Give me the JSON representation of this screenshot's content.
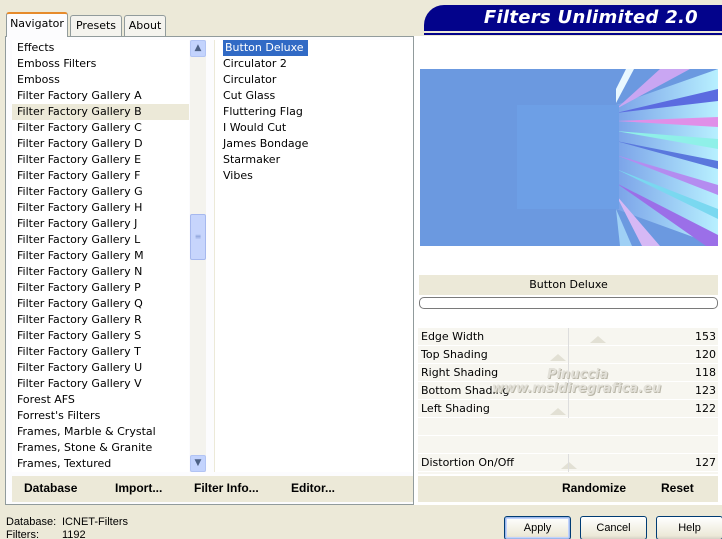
{
  "app_title": "Filters Unlimited 2.0",
  "tabs": [
    {
      "label": "Navigator",
      "active": true
    },
    {
      "label": "Presets",
      "active": false
    },
    {
      "label": "About",
      "active": false
    }
  ],
  "categories": [
    "Effects",
    "Emboss Filters",
    "Emboss",
    "Filter Factory Gallery A",
    "Filter Factory Gallery B",
    "Filter Factory Gallery C",
    "Filter Factory Gallery D",
    "Filter Factory Gallery E",
    "Filter Factory Gallery F",
    "Filter Factory Gallery G",
    "Filter Factory Gallery H",
    "Filter Factory Gallery J",
    "Filter Factory Gallery L",
    "Filter Factory Gallery M",
    "Filter Factory Gallery N",
    "Filter Factory Gallery P",
    "Filter Factory Gallery Q",
    "Filter Factory Gallery R",
    "Filter Factory Gallery S",
    "Filter Factory Gallery T",
    "Filter Factory Gallery U",
    "Filter Factory Gallery V",
    "Forest AFS",
    "Forrest's Filters",
    "Frames, Marble & Crystal",
    "Frames, Stone & Granite",
    "Frames, Textured"
  ],
  "selected_category_index": 4,
  "filters": [
    "Button Deluxe",
    "Circulator 2",
    "Circulator",
    "Cut Glass",
    "Fluttering Flag",
    "I Would Cut",
    "James Bondage",
    "Starmaker",
    "Vibes"
  ],
  "selected_filter_index": 0,
  "left_buttons": {
    "database": "Database",
    "import": "Import...",
    "filter_info": "Filter Info...",
    "editor": "Editor..."
  },
  "current_filter": "Button Deluxe",
  "params": [
    {
      "label": "Edge Width",
      "value": "153",
      "level": 153
    },
    {
      "label": "Top Shading",
      "value": "120",
      "level": 120
    },
    {
      "label": "Right Shading",
      "value": "118",
      "level": 118
    },
    {
      "label": "Bottom Shading",
      "value": "123",
      "level": 123
    },
    {
      "label": "Left Shading",
      "value": "122",
      "level": 122
    }
  ],
  "distortion": {
    "label": "Distortion On/Off",
    "value": "127",
    "level": 127
  },
  "watermark_lines": [
    "Pinuccia",
    "www.msldiregrafica.eu"
  ],
  "right_buttons": {
    "randomize": "Randomize",
    "reset": "Reset"
  },
  "footer": {
    "database_label": "Database:",
    "database_value": "ICNET-Filters",
    "filters_label": "Filters:",
    "filters_value": "1192"
  },
  "dialog_buttons": {
    "apply": "Apply",
    "cancel": "Cancel",
    "help": "Help"
  },
  "colors": {
    "banner": "#03038b",
    "selection": "#316ac5",
    "preview_bg": "#6e9ae2"
  }
}
